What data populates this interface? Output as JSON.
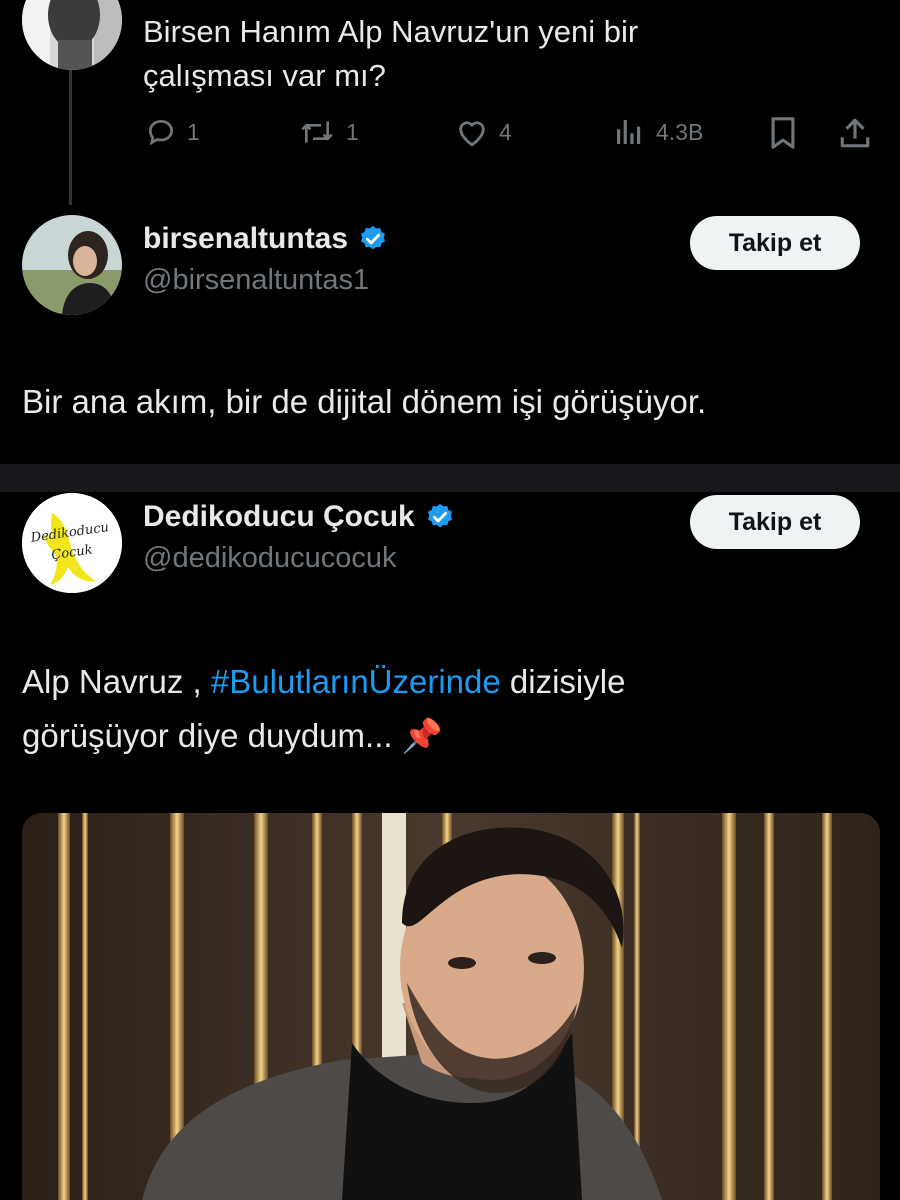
{
  "tweet1": {
    "text_line1": "Birsen Hanım Alp Navruz'un yeni bir",
    "text_line2": "çalışması var mı?",
    "replies": "1",
    "retweets": "1",
    "likes": "4",
    "views": "4.3B"
  },
  "tweet2": {
    "display_name": "birsenaltuntas",
    "handle": "@birsenaltuntas1",
    "follow_label": "Takip et",
    "text": "Bir ana akım, bir de dijital dönem işi görüşüyor."
  },
  "tweet3": {
    "display_name": "Dedikoducu Çocuk",
    "handle": "@dedikoducucocuk",
    "follow_label": "Takip et",
    "text_prefix": "Alp Navruz , ",
    "hashtag": "#BulutlarınÜzerinde",
    "text_suffix": " dizisiyle",
    "text_line2": "görüşüyor diye duydum... 📌",
    "avatar_logo_line1": "Dedikoducu",
    "avatar_logo_line2": "Çocuk"
  },
  "colors": {
    "background": "#000000",
    "text": "#e7e9ea",
    "muted": "#71767b",
    "link": "#1d9bf0",
    "verified": "#1d9bf0",
    "button_bg": "#eff3f4"
  }
}
